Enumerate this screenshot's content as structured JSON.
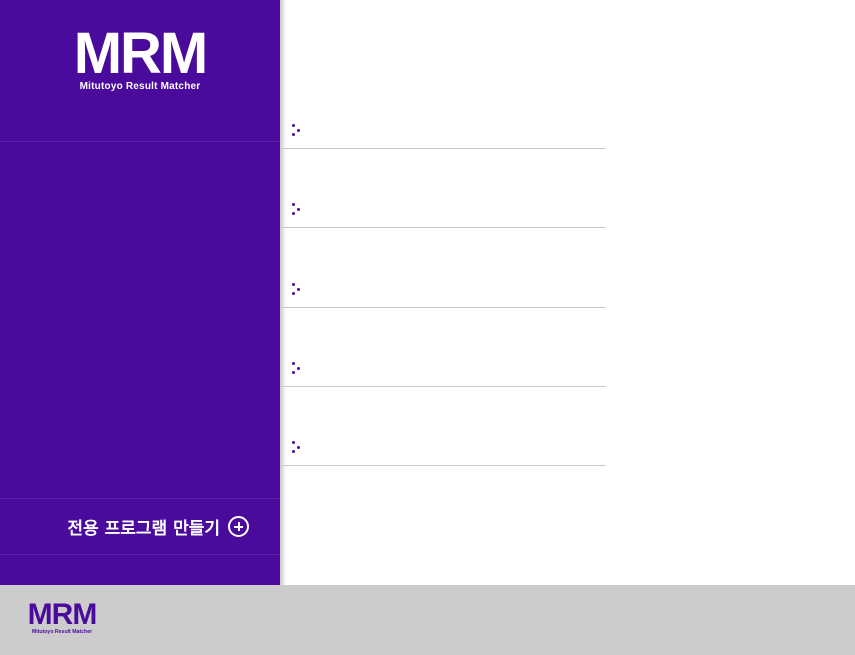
{
  "brand": {
    "mark": "MRM",
    "subtitle": "Mitutoyo Result Matcher",
    "color": "#4a0a9c"
  },
  "sidebar": {
    "create_program_label": "전용 프로그램 만들기",
    "create_program_icon": "plus-circle-icon"
  },
  "program_list": {
    "items": [
      {
        "label": "",
        "icon": "bullet-dots-icon"
      },
      {
        "label": "",
        "icon": "bullet-dots-icon"
      },
      {
        "label": "",
        "icon": "bullet-dots-icon"
      },
      {
        "label": "",
        "icon": "bullet-dots-icon"
      },
      {
        "label": "",
        "icon": "bullet-dots-icon"
      }
    ]
  },
  "footer": {
    "logo_mark": "MRM",
    "logo_subtitle": "Mitutoyo Result Matcher"
  }
}
